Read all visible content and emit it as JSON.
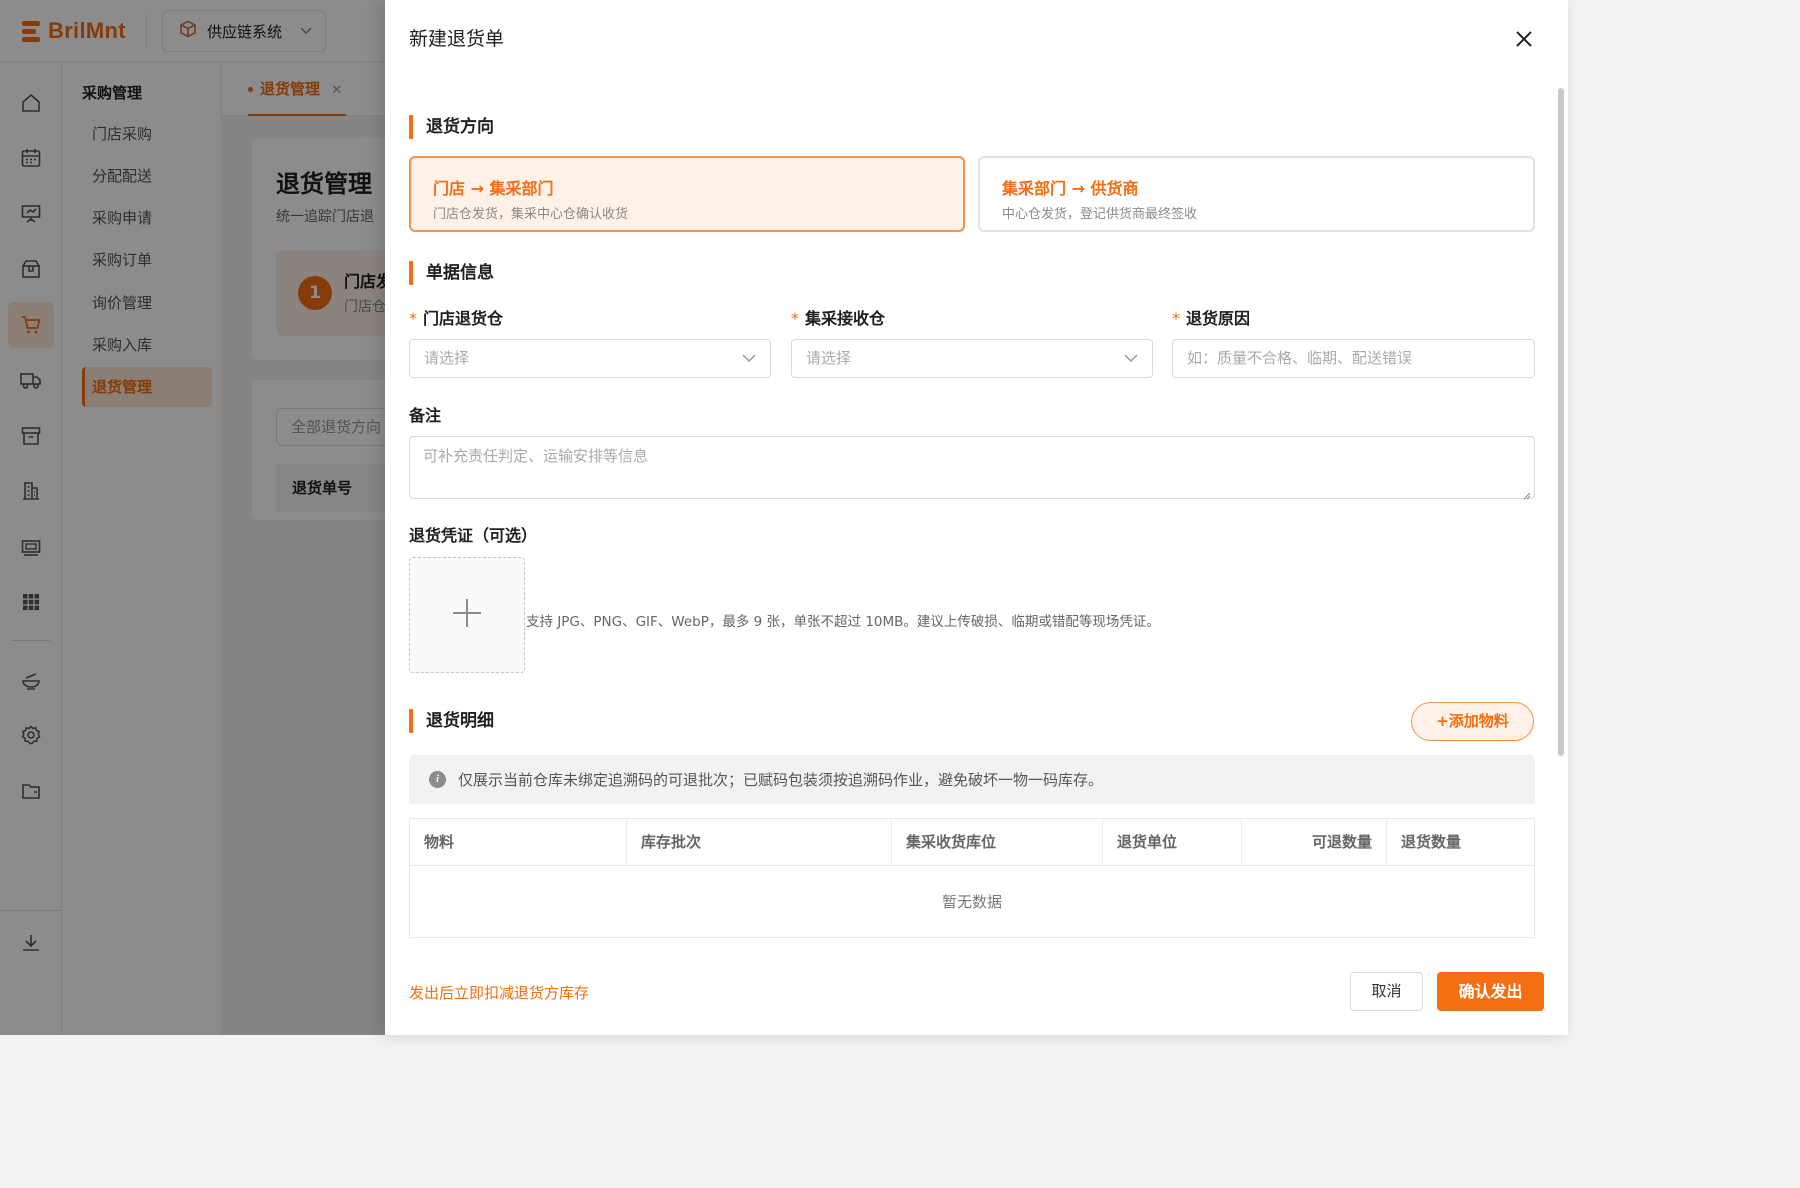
{
  "app": {
    "logo_text": "BrilMnt",
    "system_select": "供应链系统"
  },
  "subnav": {
    "title": "采购管理",
    "items": [
      {
        "label": "门店采购"
      },
      {
        "label": "分配配送"
      },
      {
        "label": "采购申请"
      },
      {
        "label": "采购订单"
      },
      {
        "label": "询价管理"
      },
      {
        "label": "采购入库"
      },
      {
        "label": "退货管理"
      }
    ],
    "active_index": 6
  },
  "rail": {
    "icons": [
      "home-icon",
      "calendar-icon",
      "presentation-icon",
      "gift-box-icon",
      "cart-icon",
      "truck-icon",
      "archive-icon",
      "building-icon",
      "money-icon",
      "grid-icon",
      "dish-icon",
      "gear-icon",
      "folder-icon",
      "download-icon"
    ]
  },
  "tabs": [
    {
      "label": "退货管理"
    }
  ],
  "page": {
    "title": "退货管理",
    "subtitle": "统一追踪门店退",
    "step_num": "1",
    "step_title": "门店发",
    "step_sub": "门店仓",
    "filter_placeholder": "全部退货方向",
    "table_header": "退货单号"
  },
  "drawer": {
    "title": "新建退货单",
    "section_direction": "退货方向",
    "directions": [
      {
        "title": "门店 → 集采部门",
        "desc": "门店仓发货，集采中心仓确认收货",
        "selected": true
      },
      {
        "title": "集采部门 → 供货商",
        "desc": "中心仓发货，登记供货商最终签收",
        "selected": false
      }
    ],
    "section_info": "单据信息",
    "fields": {
      "store_wh": {
        "label": "门店退货仓",
        "placeholder": "请选择"
      },
      "central_wh": {
        "label": "集采接收仓",
        "placeholder": "请选择"
      },
      "reason": {
        "label": "退货原因",
        "placeholder": "如：质量不合格、临期、配送错误"
      }
    },
    "required_mark": "*",
    "note_label": "备注",
    "note_placeholder": "可补充责任判定、运输安排等信息",
    "upload_label": "退货凭证（可选）",
    "upload_hint": "支持 JPG、PNG、GIF、WebP，最多 9 张，单张不超过 10MB。建议上传破损、临期或错配等现场凭证。",
    "section_detail": "退货明细",
    "add_button": "+添加物料",
    "alert": "仅展示当前仓库未绑定追溯码的可退批次；已赋码包装须按追溯码作业，避免破坏一物一码库存。",
    "columns": [
      "物料",
      "库存批次",
      "集采收货库位",
      "退货单位",
      "可退数量",
      "退货数量"
    ],
    "empty_text": "暂无数据",
    "footer_note": "发出后立即扣减退货方库存",
    "cancel": "取消",
    "confirm": "确认发出"
  },
  "colors": {
    "accent": "#f46e12",
    "accent_light": "#fdf1e8",
    "mask": "rgba(0,0,0,0.45)"
  }
}
